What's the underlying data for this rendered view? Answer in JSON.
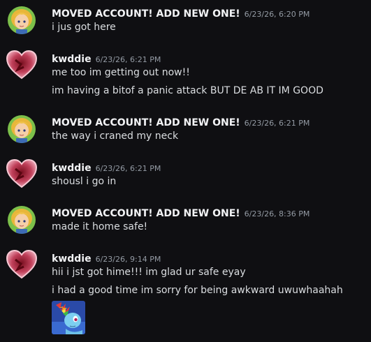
{
  "messages": [
    {
      "author": "MOVED ACCOUNT! ADD NEW ONE!",
      "timestamp": "6/23/26, 6:20 PM",
      "avatar": "blonde-girl-avatar",
      "lines": [
        "i jus got here"
      ]
    },
    {
      "author": "kwddie",
      "timestamp": "6/23/26, 6:21 PM",
      "avatar": "pink-heart-avatar",
      "lines": [
        "me too im getting out now!!",
        "im having a bitof a panic attack BUT DE AB IT IM GOOD"
      ]
    },
    {
      "author": "MOVED ACCOUNT! ADD NEW ONE!",
      "timestamp": "6/23/26, 6:21 PM",
      "avatar": "blonde-girl-avatar",
      "lines": [
        "the way i craned my neck"
      ]
    },
    {
      "author": "kwddie",
      "timestamp": "6/23/26, 6:21 PM",
      "avatar": "pink-heart-avatar",
      "lines": [
        "shousl i go in"
      ]
    },
    {
      "author": "MOVED ACCOUNT! ADD NEW ONE!",
      "timestamp": "6/23/26, 8:36 PM",
      "avatar": "blonde-girl-avatar",
      "lines": [
        "made it home safe!"
      ]
    },
    {
      "author": "kwddie",
      "timestamp": "6/23/26, 9:14 PM",
      "avatar": "pink-heart-avatar",
      "lines": [
        "hii i jst got hime!!! im glad ur safe eyay",
        "i had a good time im sorry for being awkward uwuwhaahah"
      ],
      "attachment": "rainbow-dash-image-thumbnail"
    }
  ],
  "colors": {
    "background": "#0f0f12",
    "username": "#f2f3f5",
    "message_text": "#dbdee1",
    "timestamp": "#949ba4"
  }
}
